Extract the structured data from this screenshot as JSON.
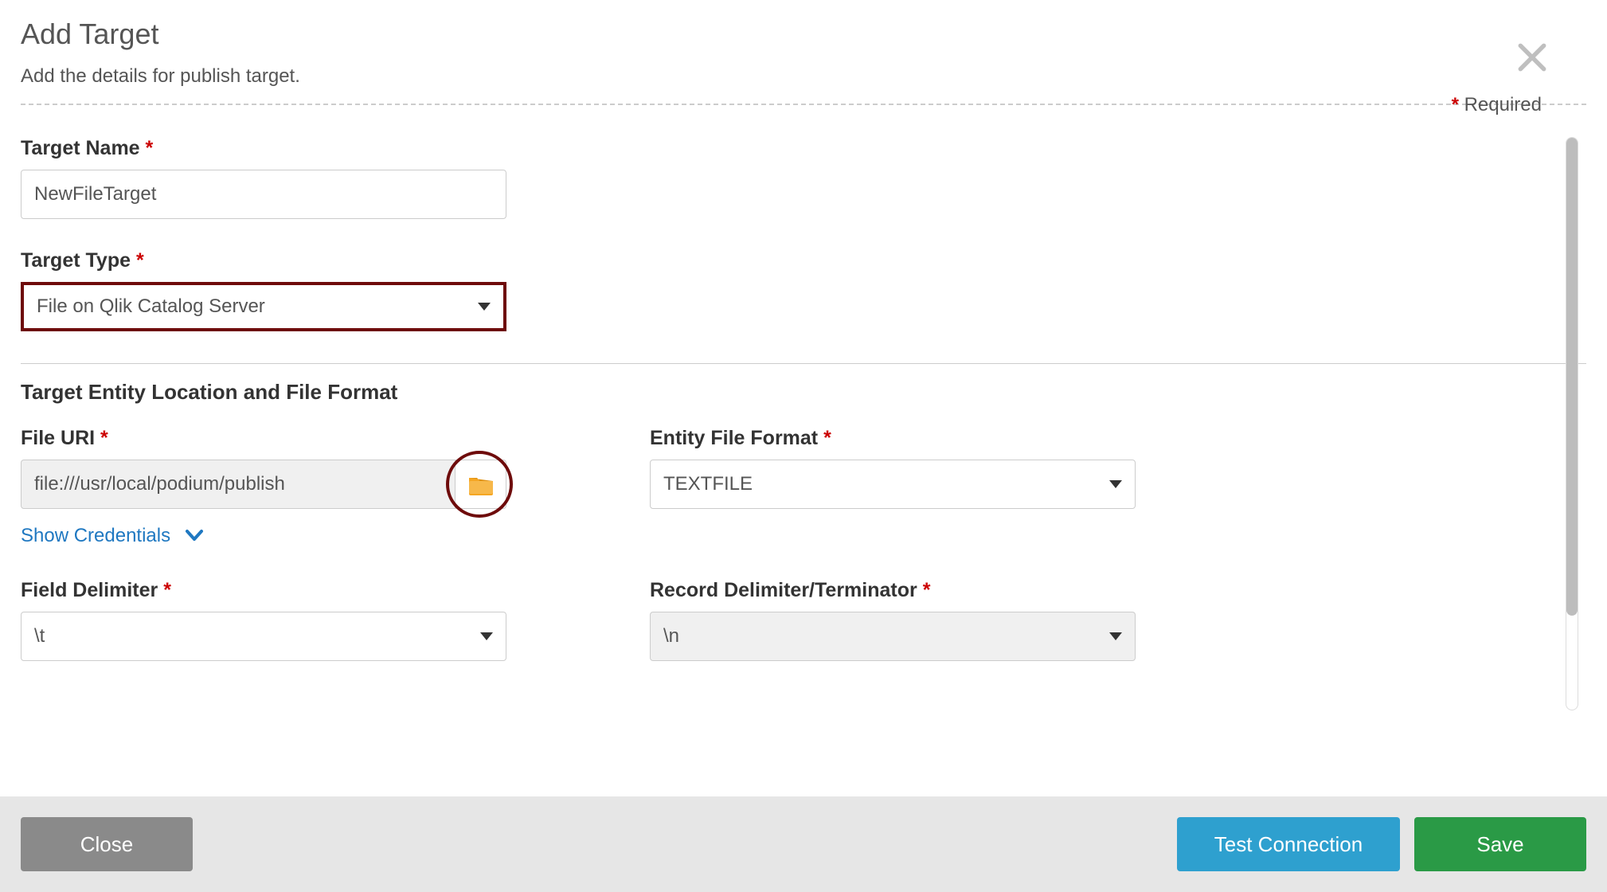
{
  "header": {
    "title": "Add Target",
    "subtitle": "Add the details for publish target.",
    "required_label": "Required"
  },
  "form": {
    "target_name": {
      "label": "Target Name",
      "value": "NewFileTarget"
    },
    "target_type": {
      "label": "Target Type",
      "value": "File on Qlik Catalog Server"
    },
    "section_heading": "Target Entity Location and File Format",
    "file_uri": {
      "label": "File URI",
      "value": "file:///usr/local/podium/publish"
    },
    "show_credentials": "Show Credentials",
    "entity_file_format": {
      "label": "Entity File Format",
      "value": "TEXTFILE"
    },
    "field_delimiter": {
      "label": "Field Delimiter",
      "value": "\\t"
    },
    "record_delimiter": {
      "label": "Record Delimiter/Terminator",
      "value": "\\n"
    }
  },
  "footer": {
    "close": "Close",
    "test": "Test Connection",
    "save": "Save"
  }
}
